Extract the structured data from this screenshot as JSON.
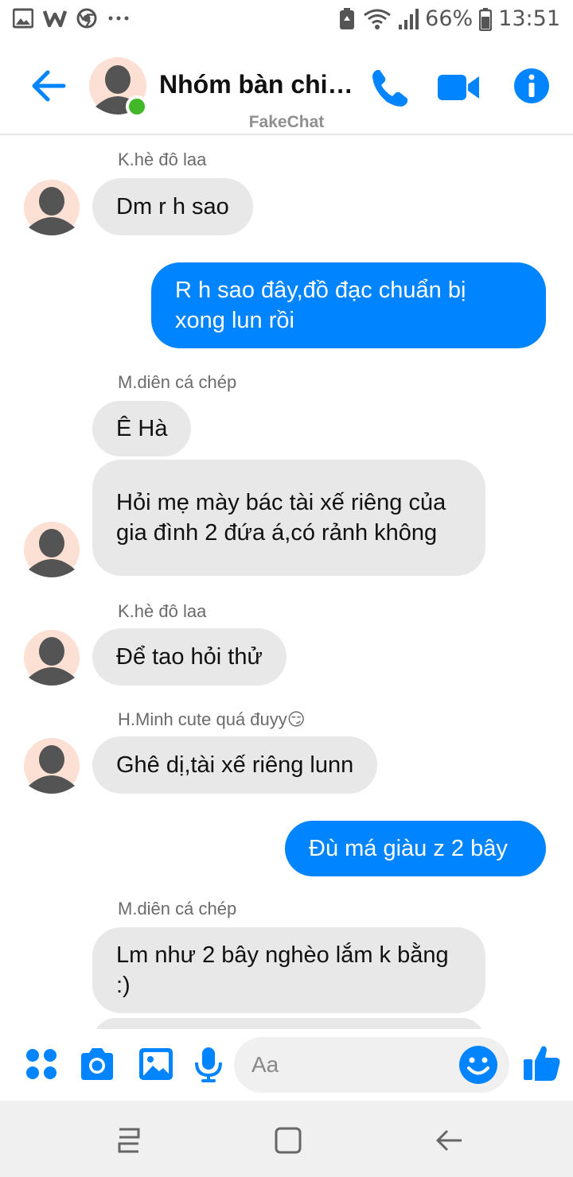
{
  "status_bar": {
    "battery": "66%",
    "time": "13:51"
  },
  "header": {
    "title": "Nhóm bàn chiệ…",
    "watermark": "FakeChat"
  },
  "messages": [
    {
      "sender": "K.hè đô laa"
    },
    {
      "text": "Dm r h sao"
    },
    {
      "text": "R h sao đây,đồ đạc chuẩn bị xong lun rồi"
    },
    {
      "sender": "M.diên cá chép"
    },
    {
      "text": "Ê Hà"
    },
    {
      "text": "Hỏi mẹ mày bác tài xế riêng của gia đình 2 đứa á,có rảnh không"
    },
    {
      "sender": "K.hè đô laa"
    },
    {
      "text": "Để tao hỏi thử"
    },
    {
      "sender": "H.Minh cute quá đuyy😏"
    },
    {
      "text": "Ghê dị,tài xế riêng lunn"
    },
    {
      "text": "Đù má giàu z 2 bây"
    },
    {
      "sender": "M.diên cá chép"
    },
    {
      "text": "Lm như 2 bây nghèo lắm k bằng :)"
    }
  ],
  "composer": {
    "placeholder": "Aa"
  },
  "colors": {
    "accent": "#0084ff",
    "incoming_bubble": "#e8e8e8",
    "online": "#42b72a"
  }
}
